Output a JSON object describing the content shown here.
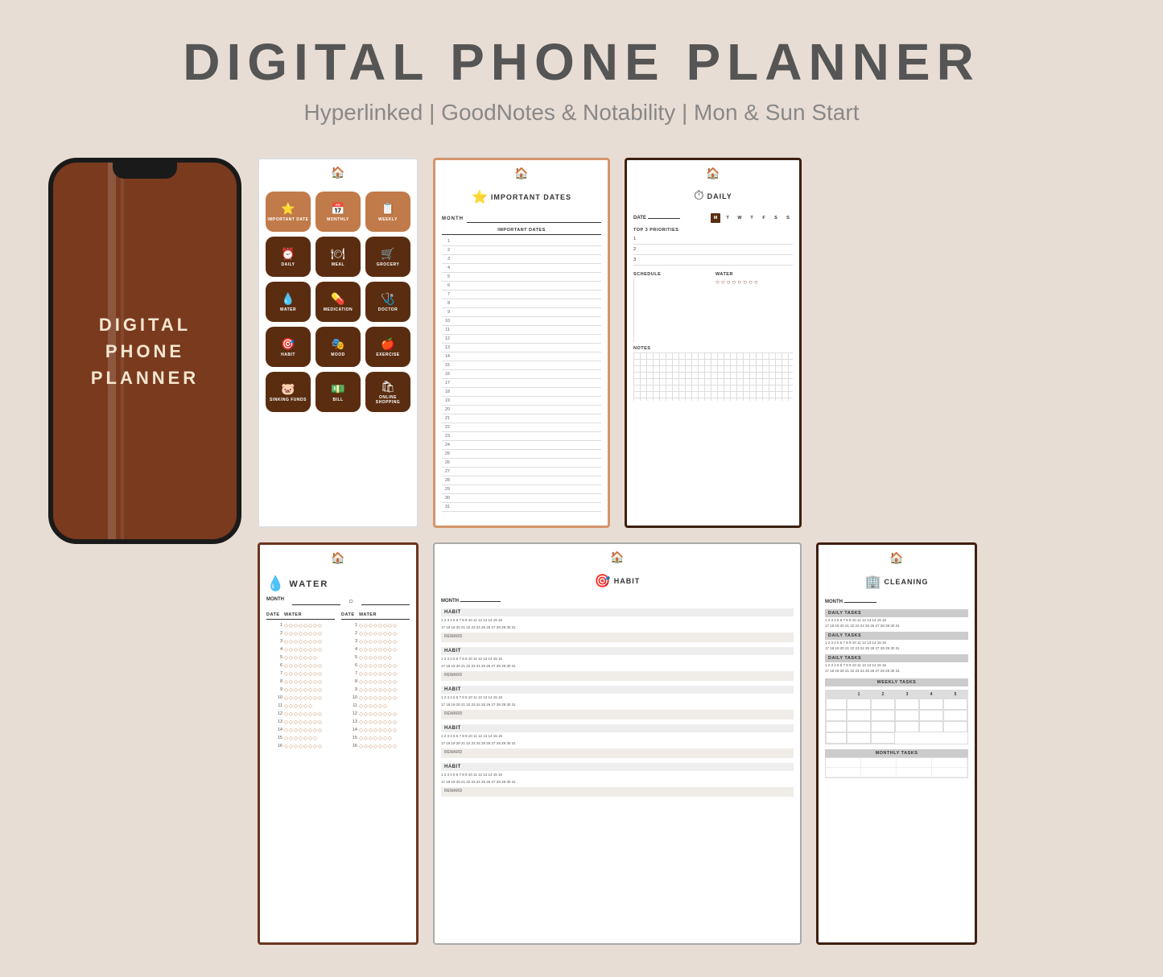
{
  "header": {
    "main_title": "DIGITAL PHONE PLANNER",
    "subtitle": "Hyperlinked | GoodNotes & Notability | Mon & Sun Start"
  },
  "phone": {
    "title_line1": "DIGITAL",
    "title_line2": "PHONE",
    "title_line3": "PLANNER"
  },
  "menu_page": {
    "items": [
      {
        "label": "IMPORTANT DATE",
        "icon": "⭐",
        "dark": false
      },
      {
        "label": "MONTHLY",
        "icon": "📅",
        "dark": false
      },
      {
        "label": "WEEKLY",
        "icon": "📋",
        "dark": false
      },
      {
        "label": "DAILY",
        "icon": "⏰",
        "dark": true
      },
      {
        "label": "MEAL",
        "icon": "🍽",
        "dark": true
      },
      {
        "label": "GROCERY",
        "icon": "🛒",
        "dark": true
      },
      {
        "label": "WATER",
        "icon": "💧",
        "dark": true
      },
      {
        "label": "MEDICATION",
        "icon": "💊",
        "dark": true
      },
      {
        "label": "DOCTOR",
        "icon": "🩺",
        "dark": true
      },
      {
        "label": "HABIT",
        "icon": "🎯",
        "dark": true
      },
      {
        "label": "MOOD",
        "icon": "🎭",
        "dark": true
      },
      {
        "label": "EXERCISE",
        "icon": "🍎",
        "dark": true
      },
      {
        "label": "SINKING FUNDS",
        "icon": "🐷",
        "dark": true
      },
      {
        "label": "BILL",
        "icon": "💵",
        "dark": true
      },
      {
        "label": "ONLINE SHOPPING",
        "icon": "🛍",
        "dark": true
      }
    ]
  },
  "important_dates_page": {
    "title": "IMPORTANT DATES",
    "section_title": "IMPORTANT DATES",
    "month_label": "MONTH",
    "numbers": [
      1,
      2,
      3,
      4,
      5,
      6,
      7,
      8,
      9,
      10,
      11,
      12,
      13,
      14,
      15,
      16,
      17,
      18,
      19,
      20,
      21,
      22,
      23,
      24,
      25,
      26,
      27,
      28,
      29,
      30,
      31
    ]
  },
  "daily_page": {
    "title": "DAILY",
    "date_label": "DATE",
    "day_letters": [
      "M",
      "T",
      "W",
      "T",
      "F",
      "S",
      "S"
    ],
    "priorities_label": "TOP 3 PRIORITIES",
    "schedule_label": "SCHEDULE",
    "water_label": "WATER",
    "notes_label": "NOTES",
    "priorities": [
      "1",
      "2",
      "3"
    ],
    "drops": 8
  },
  "water_page": {
    "title": "WATER",
    "month_label": "MONTH",
    "date_col": "DATE",
    "water_col": "WATER",
    "num_rows": 16,
    "drops_per_row": 8
  },
  "habit_page": {
    "title": "HABIT",
    "month_label": "MONTH",
    "habits_label": "HABIT",
    "reward_label": "REWARD",
    "sections": [
      {
        "nums_row1": "1 2 3 4 5 6 7 8 9 10 11 12 13 14 15 16",
        "nums_row2": "17 18 19 20 21 22 23 24 25 26 27 28 29 30 31"
      },
      {
        "nums_row1": "1 2 3 4 5 6 7 8 9 10 11 12 13 14 15 16",
        "nums_row2": "17 18 19 20 21 22 23 24 25 26 27 28 29 30 31"
      },
      {
        "nums_row1": "1 2 3 4 5 6 7 8 9 10 11 12 13 14 15 16",
        "nums_row2": "17 18 19 20 21 22 23 24 25 26 27 28 29 30 31"
      },
      {
        "nums_row1": "1 2 3 4 5 6 7 8 9 10 11 12 13 14 15 16",
        "nums_row2": "17 18 19 20 21 22 23 24 25 26 27 28 29 30 31"
      },
      {
        "nums_row1": "1 2 3 4 5 6 7 8 9 10 11 12 13 14 15 16",
        "nums_row2": "17 18 19 20 21 22 23 24 25 26 27 28 29 30 31"
      }
    ]
  },
  "cleaning_page": {
    "title": "CLEANING",
    "month_label": "MONTH",
    "daily_tasks_label": "DAILY TASKS",
    "weekly_tasks_label": "WEEKLY TASKS",
    "monthly_tasks_label": "MONTHLY TASKS",
    "week_cols": [
      "1",
      "2",
      "3",
      "4",
      "5"
    ]
  },
  "colors": {
    "brown_dark": "#6b3520",
    "brown_medium": "#7a3a1e",
    "brown_light": "#c17a4a",
    "peach": "#d4956b",
    "bg": "#e8ddd4"
  }
}
